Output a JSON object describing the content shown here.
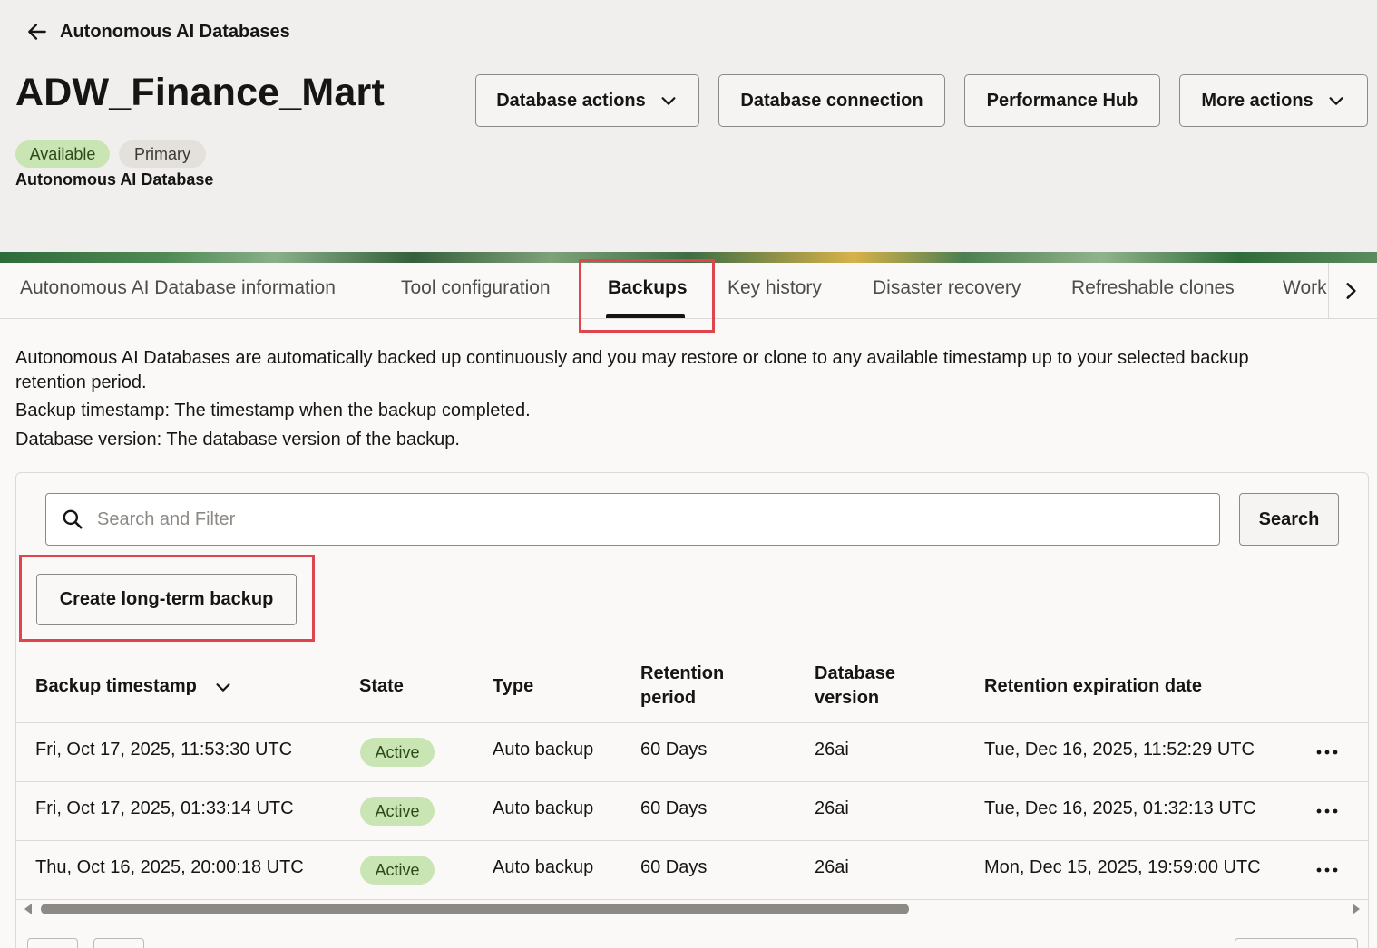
{
  "header": {
    "back_label": "Autonomous AI Databases",
    "title": "ADW_Finance_Mart",
    "badges": {
      "available": "Available",
      "primary": "Primary"
    },
    "subtitle": "Autonomous AI Database",
    "actions": {
      "database_actions": "Database actions",
      "database_connection": "Database connection",
      "performance_hub": "Performance Hub",
      "more_actions": "More actions"
    }
  },
  "tabs": [
    {
      "label": "Autonomous AI Database information"
    },
    {
      "label": "Tool configuration"
    },
    {
      "label": "Backups",
      "active": true
    },
    {
      "label": "Key history"
    },
    {
      "label": "Disaster recovery"
    },
    {
      "label": "Refreshable clones"
    },
    {
      "label": "Work"
    }
  ],
  "description": {
    "line1": "Autonomous AI Databases are automatically backed up continuously and you may restore or clone to any available timestamp up to your selected backup",
    "line1b": "retention period.",
    "line2": "Backup timestamp: The timestamp when the backup completed.",
    "line3": "Database version: The database version of the backup."
  },
  "search": {
    "placeholder": "Search and Filter",
    "button_label": "Search"
  },
  "create_backup_label": "Create long-term backup",
  "table": {
    "headers": {
      "timestamp": "Backup timestamp",
      "state": "State",
      "type": "Type",
      "retention_1": "Retention",
      "retention_2": "period",
      "version_1": "Database",
      "version_2": "version",
      "expiration": "Retention expiration date"
    },
    "rows": [
      {
        "timestamp": "Fri, Oct 17, 2025, 11:53:30 UTC",
        "state": "Active",
        "type": "Auto backup",
        "retention": "60 Days",
        "version": "26ai",
        "expiration": "Tue, Dec 16, 2025, 11:52:29 UTC"
      },
      {
        "timestamp": "Fri, Oct 17, 2025, 01:33:14 UTC",
        "state": "Active",
        "type": "Auto backup",
        "retention": "60 Days",
        "version": "26ai",
        "expiration": "Tue, Dec 16, 2025, 01:32:13 UTC"
      },
      {
        "timestamp": "Thu, Oct 16, 2025, 20:00:18 UTC",
        "state": "Active",
        "type": "Auto backup",
        "retention": "60 Days",
        "version": "26ai",
        "expiration": "Mon, Dec 15, 2025, 19:59:00 UTC"
      }
    ]
  },
  "colors": {
    "highlight": "#e0454d",
    "available_badge": "#c9e5b4",
    "primary_badge": "#e4e1dd"
  },
  "icons": {
    "back": "arrow-left-icon",
    "dropdown": "chevron-down-icon",
    "tab_next": "chevron-right-icon",
    "search": "search-icon",
    "row_actions": "more-horizontal-icon"
  }
}
